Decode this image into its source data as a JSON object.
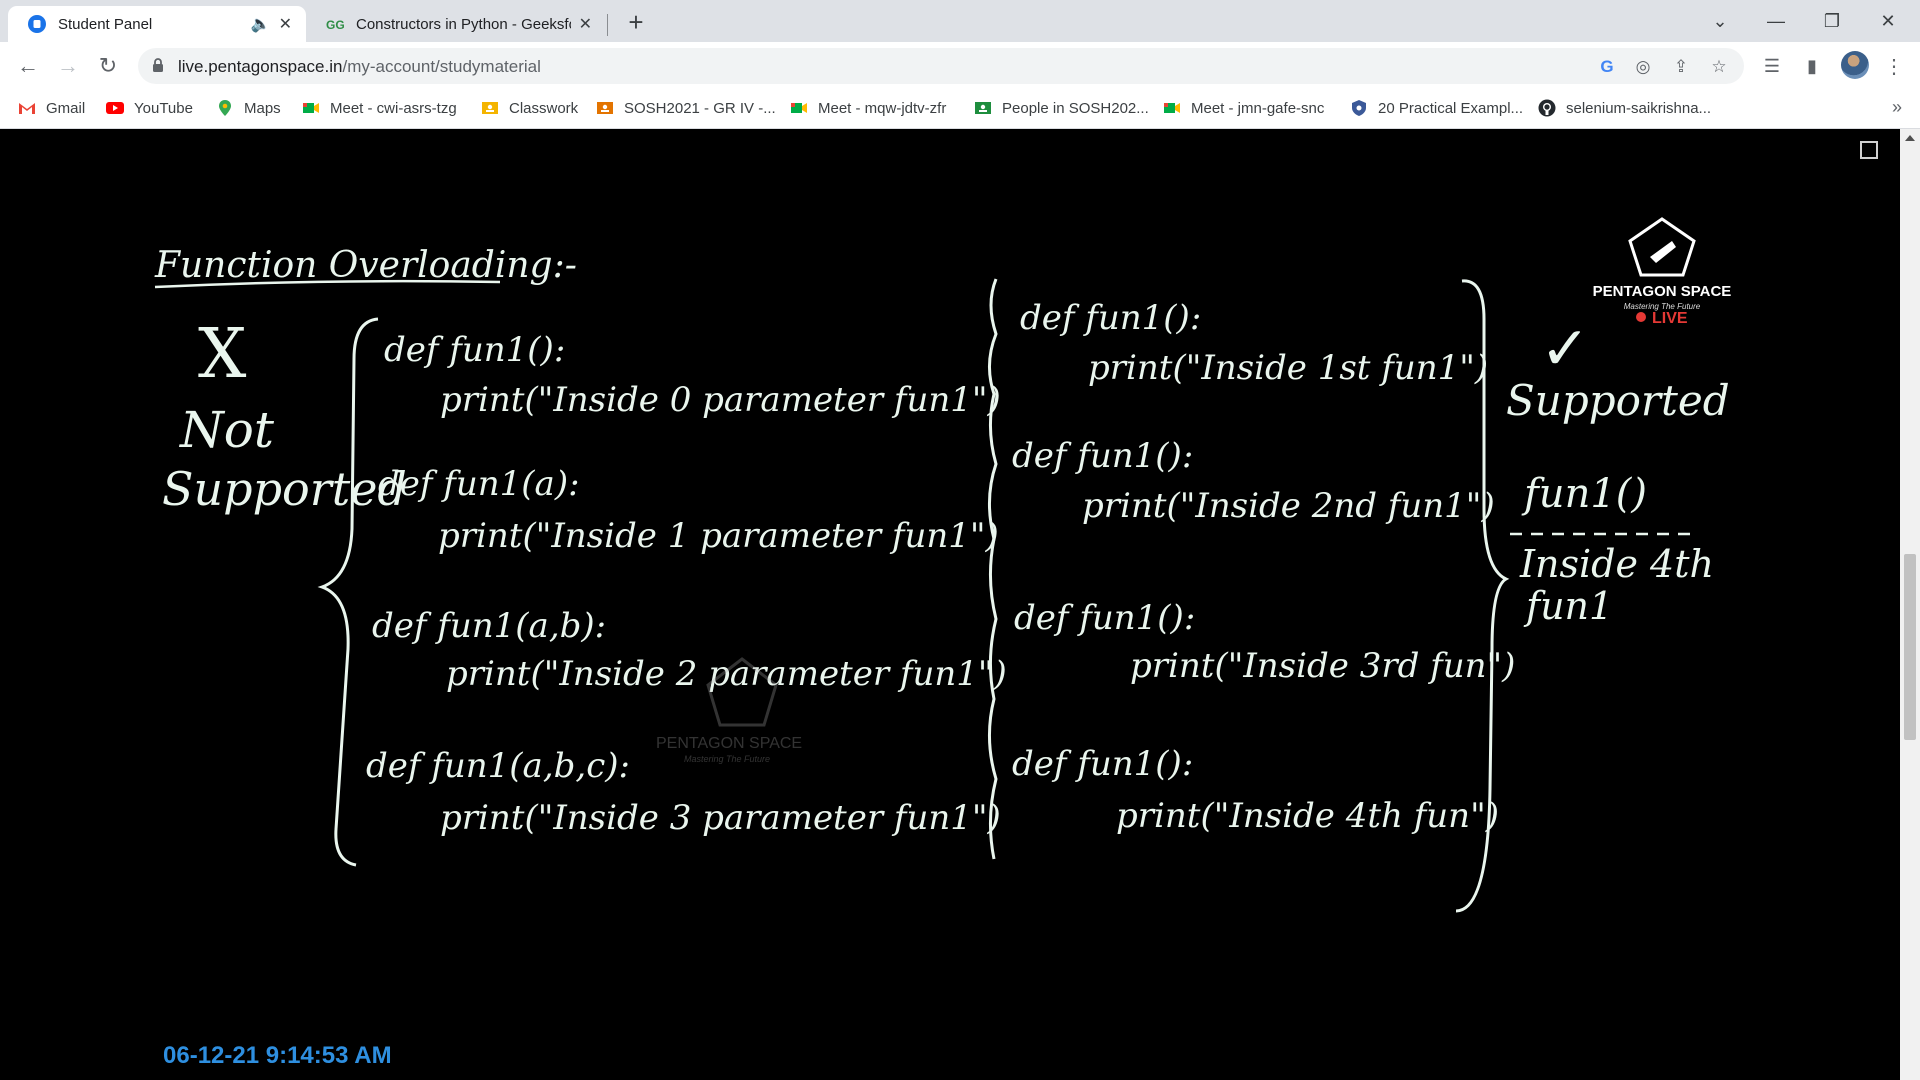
{
  "browser": {
    "tabs": [
      {
        "title": "Student Panel",
        "active": true
      },
      {
        "title": "Constructors in Python - Geeksfo",
        "active": false
      }
    ],
    "url_host": "live.pentagonspace.in",
    "url_path": "/my-account/studymaterial"
  },
  "bookmarks": [
    {
      "label": "Gmail",
      "icon": "gmail-icon"
    },
    {
      "label": "YouTube",
      "icon": "youtube-icon"
    },
    {
      "label": "Maps",
      "icon": "maps-icon"
    },
    {
      "label": "Meet - cwi-asrs-tzg",
      "icon": "meet-icon"
    },
    {
      "label": "Classwork",
      "icon": "classroom-icon"
    },
    {
      "label": "SOSH2021 - GR IV -...",
      "icon": "classroom-icon"
    },
    {
      "label": "Meet - mqw-jdtv-zfr",
      "icon": "meet-icon"
    },
    {
      "label": "People in SOSH202...",
      "icon": "classroom-icon"
    },
    {
      "label": "Meet - jmn-gafe-snc",
      "icon": "meet-icon"
    },
    {
      "label": "20 Practical Exampl...",
      "icon": "shield-icon"
    },
    {
      "label": "selenium-saikrishna...",
      "icon": "github-icon"
    }
  ],
  "video": {
    "timestamp": "06-12-21 9:14:53 AM",
    "watermark_brand": "PENTAGON SPACE",
    "watermark_tagline": "Mastering The Future",
    "live_label": "LIVE",
    "board": {
      "heading": "Function Overloading:-",
      "left_mark": "X",
      "left_note": [
        "Not",
        "Supported"
      ],
      "left_code": [
        [
          "def fun1():",
          "print(\"Inside 0 parameter fun1\")"
        ],
        [
          "def fun1(a):",
          "print(\"Inside 1 parameter fun1\")"
        ],
        [
          "def fun1(a,b):",
          "print(\"Inside 2 parameter fun1\")"
        ],
        [
          "def fun1(a,b,c):",
          "print(\"Inside 3 parameter fun1\")"
        ]
      ],
      "right_code": [
        [
          "def fun1():",
          "print(\"Inside 1st fun1\")"
        ],
        [
          "def fun1():",
          "print(\"Inside 2nd fun1\")"
        ],
        [
          "def fun1():",
          "print(\"Inside 3rd fun\")"
        ],
        [
          "def fun1():",
          "print(\"Inside 4th fun\")"
        ]
      ],
      "right_mark": "✓",
      "right_note": "Supported",
      "call": "fun1()",
      "output": [
        "Inside 4th",
        "fun1"
      ]
    }
  }
}
